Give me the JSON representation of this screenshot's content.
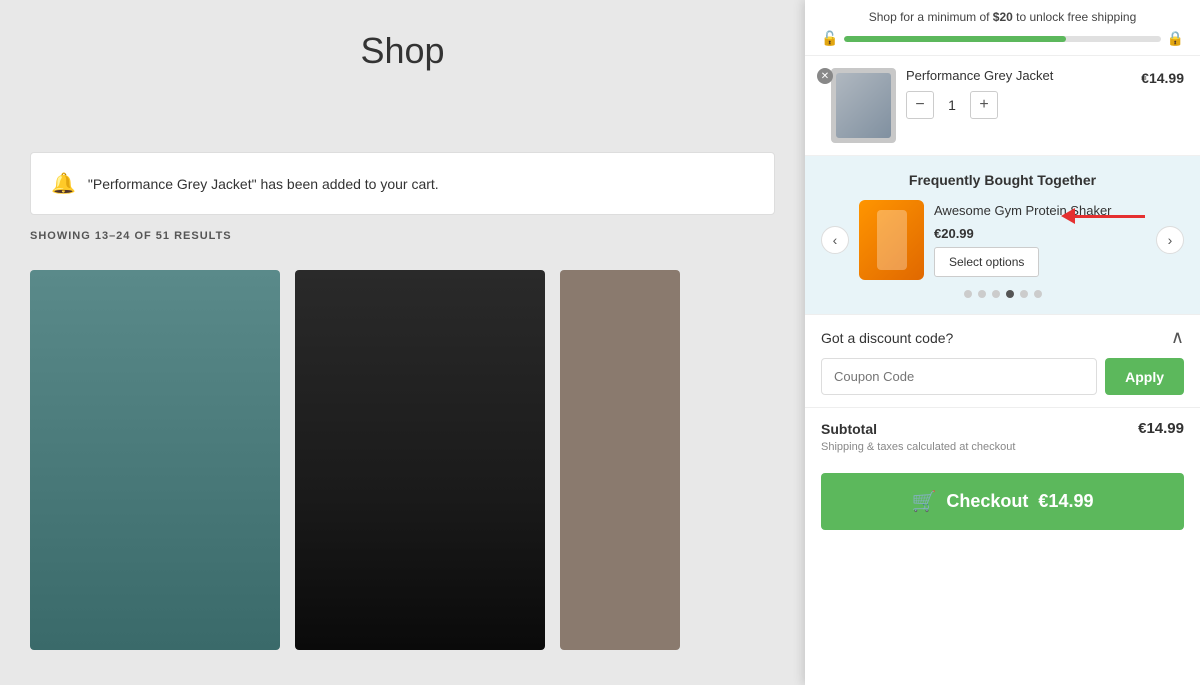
{
  "logo": {
    "icon": "⬡"
  },
  "shop": {
    "title": "Shop",
    "notification": {
      "message": "\"Performance Grey Jacket\" has been added to your cart."
    },
    "showing": "SHOWING 13–24 OF 51 RESULTS"
  },
  "cart": {
    "shipping": {
      "text_prefix": "Shop for a minimum of ",
      "amount": "$20",
      "text_suffix": " to unlock free shipping"
    },
    "item": {
      "name": "Performance Grey Jacket",
      "price": "€14.99",
      "quantity": "1"
    },
    "fbt": {
      "title": "Frequently Bought Together",
      "product_name": "Awesome Gym Protein Shaker",
      "product_price": "€20.99",
      "select_btn": "Select options",
      "dots": [
        false,
        false,
        false,
        true,
        false,
        false
      ]
    },
    "discount": {
      "label": "Got a discount code?",
      "placeholder": "Coupon Code",
      "apply_btn": "Apply"
    },
    "subtotal": {
      "label": "Subtotal",
      "amount": "€14.99",
      "shipping_note": "Shipping & taxes calculated at checkout"
    },
    "checkout": {
      "label": "Checkout",
      "price": "€14.99"
    }
  }
}
